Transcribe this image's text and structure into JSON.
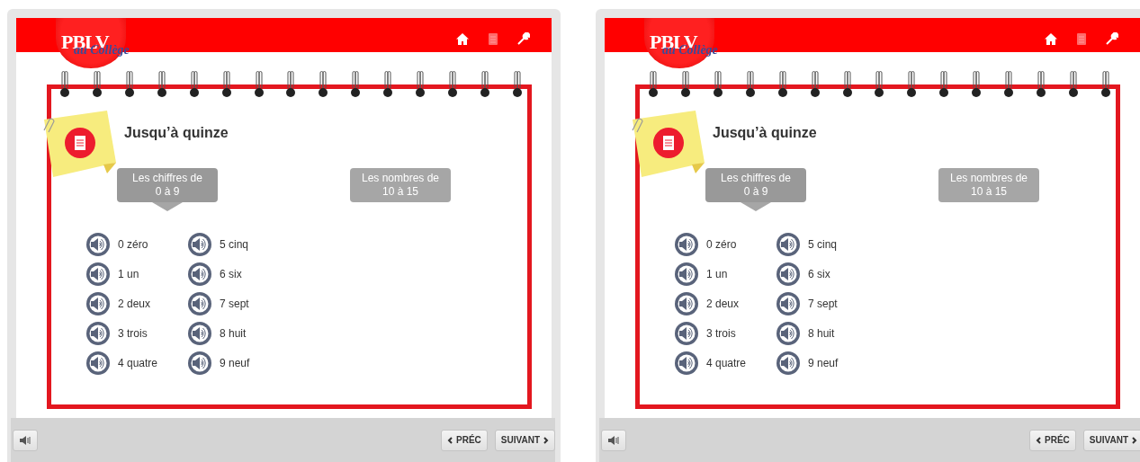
{
  "panels": [
    {
      "logo": {
        "title": "PBLV",
        "subtitle": "au Collège"
      },
      "title": "Jusqu’à quinze",
      "tabs": [
        {
          "line1": "Les chiffres de",
          "line2": "0 à 9",
          "selected": true
        },
        {
          "line1": "Les nombres de",
          "line2": "10 à 15",
          "selected": false
        }
      ],
      "words": [
        "0 zéro",
        "1 un",
        "2 deux",
        "3 trois",
        "4 quatre",
        "5 cinq",
        "6 six",
        "7 sept",
        "8 huit",
        "9 neuf"
      ],
      "nav": {
        "prev": "PRÉC",
        "next": "SUIVANT"
      }
    },
    {
      "logo": {
        "title": "PBLV",
        "subtitle": "au Collège"
      },
      "title": "Jusqu’à quinze",
      "tabs": [
        {
          "line1": "Les chiffres de",
          "line2": "0 à 9",
          "selected": true
        },
        {
          "line1": "Les nombres de",
          "line2": "10 à 15",
          "selected": false
        }
      ],
      "words": [
        "0 zéro",
        "1 un",
        "2 deux",
        "3 trois",
        "4 quatre",
        "5 cinq",
        "6 six",
        "7 sept",
        "8 huit",
        "9 neuf"
      ],
      "nav": {
        "prev": "PRÉC",
        "next": "SUIVANT"
      }
    }
  ]
}
